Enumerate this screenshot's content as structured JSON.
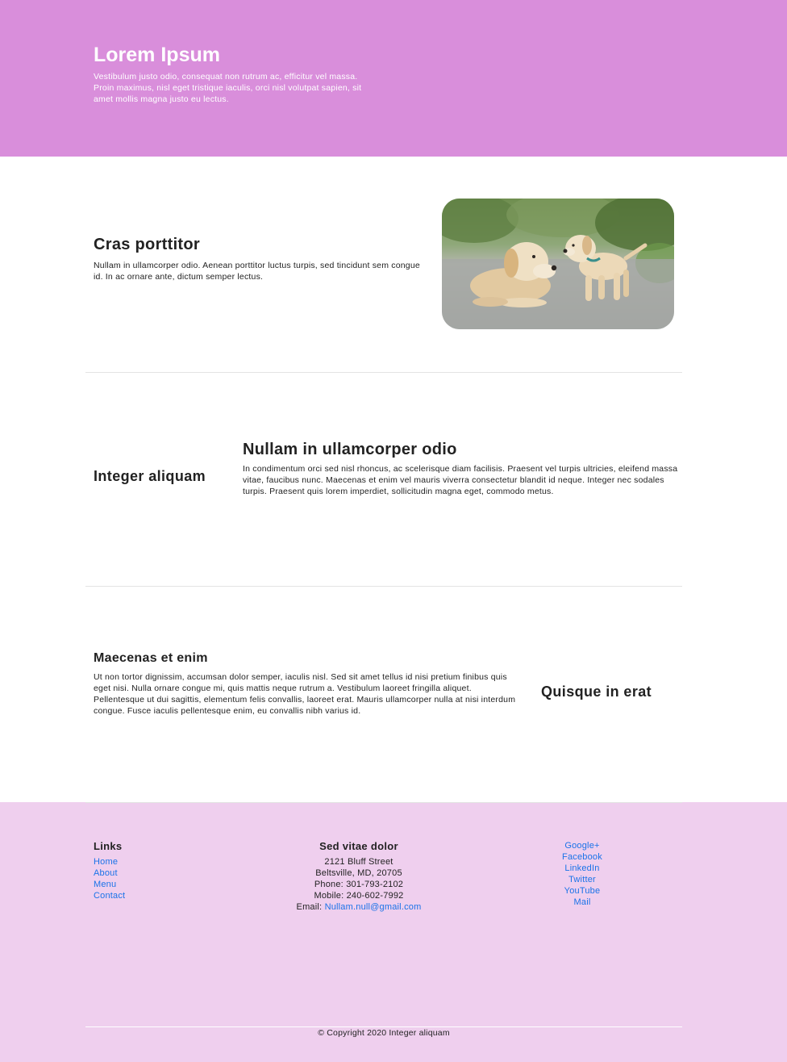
{
  "hero": {
    "title": "Lorem Ipsum",
    "text": "Vestibulum justo odio, consequat non rutrum ac, efficitur vel massa. Proin maximus, nisl eget tristique iaculis, orci nisl volutpat sapien, sit amet mollis magna justo eu lectus.",
    "background": "#d98edb"
  },
  "section1": {
    "title": "Cras porttitor",
    "text": "Nullam in ullamcorper odio. Aenean porttitor luctus turpis, sed tincidunt sem congue id. In ac ornare ante, dictum semper lectus.",
    "image": "dogs-photo"
  },
  "section2": {
    "left_heading": "Integer aliquam",
    "title": "Nullam in ullamcorper odio",
    "text": "In condimentum orci sed nisl rhoncus, ac scelerisque diam facilisis. Praesent vel turpis ultricies, eleifend massa vitae, faucibus nunc. Maecenas et enim vel mauris viverra consectetur blandit id neque. Integer nec sodales turpis. Praesent quis lorem imperdiet, sollicitudin magna eget, commodo metus."
  },
  "section3": {
    "title": "Maecenas et enim",
    "text": "Ut non tortor dignissim, accumsan dolor semper, iaculis nisl. Sed sit amet tellus id nisi pretium finibus quis eget nisi. Nulla ornare congue mi, quis mattis neque rutrum a. Vestibulum laoreet fringilla aliquet. Pellentesque ut dui sagittis, elementum felis convallis, laoreet erat. Mauris ullamcorper nulla at nisi interdum congue. Fusce iaculis pellentesque enim, eu convallis nibh varius id.",
    "right_heading": "Quisque in erat"
  },
  "footer": {
    "background": "#efcfee",
    "links_heading": "Links",
    "links": [
      "Home",
      "About",
      "Menu",
      "Contact"
    ],
    "contact": {
      "heading": "Sed vitae dolor",
      "street": "2121 Bluff Street",
      "city": "Beltsville, MD, 20705",
      "phone": "Phone: 301-793-2102",
      "mobile": "Mobile: 240-602-7992",
      "email_label": "Email: ",
      "email": "Nullam.null@gmail.com"
    },
    "social": [
      "Google+",
      "Facebook",
      "LinkedIn",
      "Twitter",
      "YouTube",
      "Mail"
    ],
    "copyright": "© Copyright 2020 Integer aliquam"
  },
  "colors": {
    "link": "#1a73e8",
    "text": "#222222"
  }
}
